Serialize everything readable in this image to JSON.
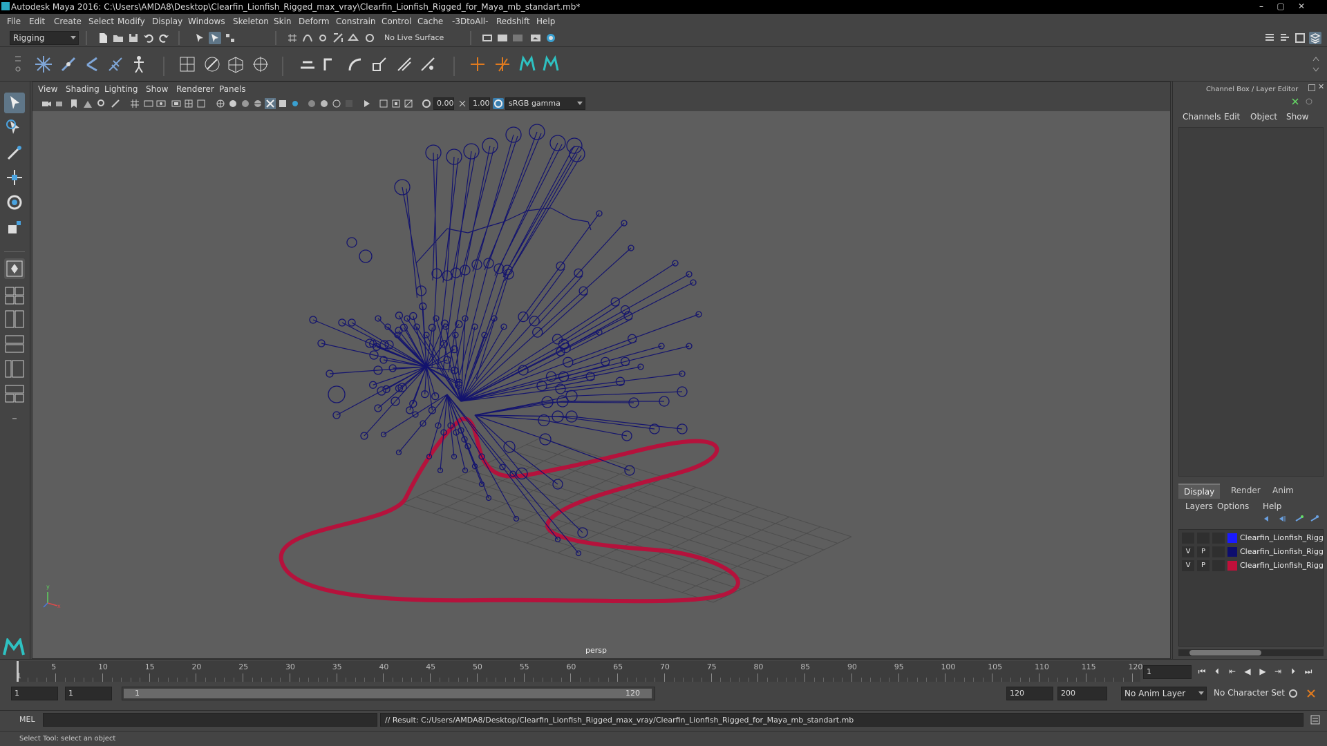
{
  "window": {
    "title": "Autodesk Maya 2016: C:\\Users\\AMDA8\\Desktop\\Clearfin_Lionfish_Rigged_max_vray\\Clearfin_Lionfish_Rigged_for_Maya_mb_standart.mb*",
    "minimize": "–",
    "maximize": "▢",
    "close": "✕"
  },
  "menubar": [
    "File",
    "Edit",
    "Create",
    "Select",
    "Modify",
    "Display",
    "Windows",
    "Skeleton",
    "Skin",
    "Deform",
    "Constrain",
    "Control",
    "Cache",
    "-3DtoAll-",
    "Redshift",
    "Help"
  ],
  "statusline": {
    "menuset": "Rigging",
    "live_surface": "No Live Surface"
  },
  "panel": {
    "menus": [
      "View",
      "Shading",
      "Lighting",
      "Show",
      "Renderer",
      "Panels"
    ],
    "exposure": "0.00",
    "gamma": "1.00",
    "color_space": "sRGB gamma",
    "camera": "persp",
    "axis_y": "y",
    "axis_x": "x"
  },
  "channel_box": {
    "title": "Channel Box / Layer Editor",
    "menus": [
      "Channels",
      "Edit",
      "Object",
      "Show"
    ]
  },
  "layer_editor": {
    "tabs": [
      "Display",
      "Render",
      "Anim"
    ],
    "menus": [
      "Layers",
      "Options",
      "Help"
    ],
    "layers": [
      {
        "v": "",
        "p": "",
        "name": "Clearfin_Lionfish_Rigg",
        "color": "#1a1aff"
      },
      {
        "v": "V",
        "p": "P",
        "name": "Clearfin_Lionfish_Rigg",
        "color": "#0d0d6e"
      },
      {
        "v": "V",
        "p": "P",
        "name": "Clearfin_Lionfish_Rigg",
        "color": "#c0103a"
      }
    ]
  },
  "timeline": {
    "labels": [
      "5",
      "10",
      "15",
      "20",
      "25",
      "30",
      "35",
      "40",
      "45",
      "50",
      "55",
      "60",
      "65",
      "70",
      "75",
      "80",
      "85",
      "90",
      "95",
      "100",
      "105",
      "110",
      "115",
      "120"
    ],
    "start_marker": "1",
    "current_frame": "1"
  },
  "range": {
    "start": "1",
    "playback_start": "1",
    "bar_start": "1",
    "bar_end": "120",
    "playback_end": "120",
    "end": "200",
    "anim_layer": "No Anim Layer",
    "character_set": "No Character Set"
  },
  "command": {
    "lang": "MEL",
    "result": "// Result: C:/Users/AMDA8/Desktop/Clearfin_Lionfish_Rigged_max_vray/Clearfin_Lionfish_Rigged_for_Maya_mb_standart.mb"
  },
  "help_line": "Select Tool: select an object",
  "colors": {
    "joint": "#14146e",
    "curve": "#b5123c",
    "grid": "#4d4d4d",
    "viewport_bg": "#5e5e5e"
  }
}
